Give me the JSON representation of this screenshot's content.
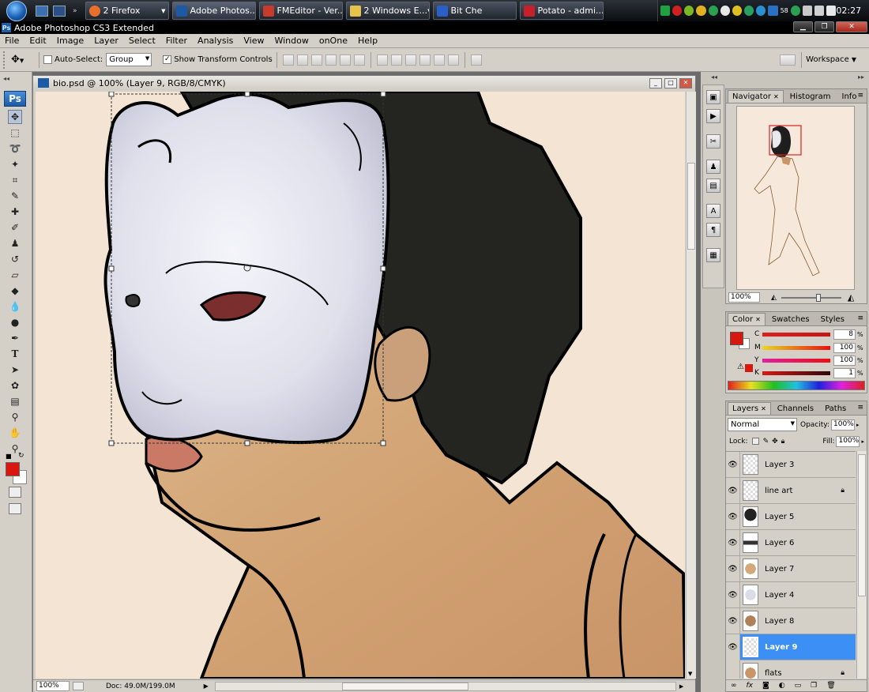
{
  "taskbar": {
    "items": [
      {
        "label": "2 Firefox",
        "color": "#e9702a"
      },
      {
        "label": "Adobe Photos...",
        "color": "#1d5aa6"
      },
      {
        "label": "FMEditor - Ver...",
        "color": "#c73a2c"
      },
      {
        "label": "2 Windows E...",
        "color": "#e6c34a"
      },
      {
        "label": "Bit Che",
        "color": "#2a5fc8"
      },
      {
        "label": "Potato - admi...",
        "color": "#c8202a"
      }
    ],
    "tray_badge": "58",
    "clock": "02:27"
  },
  "app": {
    "title": "Adobe Photoshop CS3 Extended",
    "ps_badge": "Ps"
  },
  "menubar": [
    "File",
    "Edit",
    "Image",
    "Layer",
    "Select",
    "Filter",
    "Analysis",
    "View",
    "Window",
    "onOne",
    "Help"
  ],
  "options": {
    "auto_select_label": "Auto-Select:",
    "auto_select_value": "Group",
    "show_transform_label": "Show Transform Controls",
    "workspace_label": "Workspace"
  },
  "tools": {
    "logo": "Ps"
  },
  "document": {
    "title": "bio.psd @ 100% (Layer 9, RGB/8/CMYK)",
    "zoom": "100%",
    "doc_info": "Doc: 49.0M/199.0M"
  },
  "navigator": {
    "tabs": [
      "Navigator",
      "Histogram",
      "Info"
    ],
    "zoom": "100%"
  },
  "color_panel": {
    "tabs": [
      "Color",
      "Swatches",
      "Styles"
    ],
    "channels": [
      {
        "label": "C",
        "value": "8"
      },
      {
        "label": "M",
        "value": "100"
      },
      {
        "label": "Y",
        "value": "100"
      },
      {
        "label": "K",
        "value": "1"
      }
    ],
    "foreground": "#d8180e"
  },
  "layers_panel": {
    "tabs": [
      "Layers",
      "Channels",
      "Paths"
    ],
    "blend_mode": "Normal",
    "opacity_label": "Opacity:",
    "opacity": "100%",
    "lock_label": "Lock:",
    "fill_label": "Fill:",
    "fill": "100%",
    "layers": [
      {
        "name": "Layer 3",
        "locked": false,
        "visible": true
      },
      {
        "name": "line art",
        "locked": true,
        "visible": true
      },
      {
        "name": "Layer 5",
        "locked": false,
        "visible": true
      },
      {
        "name": "Layer 6",
        "locked": false,
        "visible": true
      },
      {
        "name": "Layer 7",
        "locked": false,
        "visible": true
      },
      {
        "name": "Layer 4",
        "locked": false,
        "visible": true
      },
      {
        "name": "Layer 8",
        "locked": false,
        "visible": true
      },
      {
        "name": "Layer 9",
        "locked": false,
        "visible": true,
        "selected": true
      },
      {
        "name": "flats",
        "locked": true,
        "visible": false
      }
    ]
  }
}
